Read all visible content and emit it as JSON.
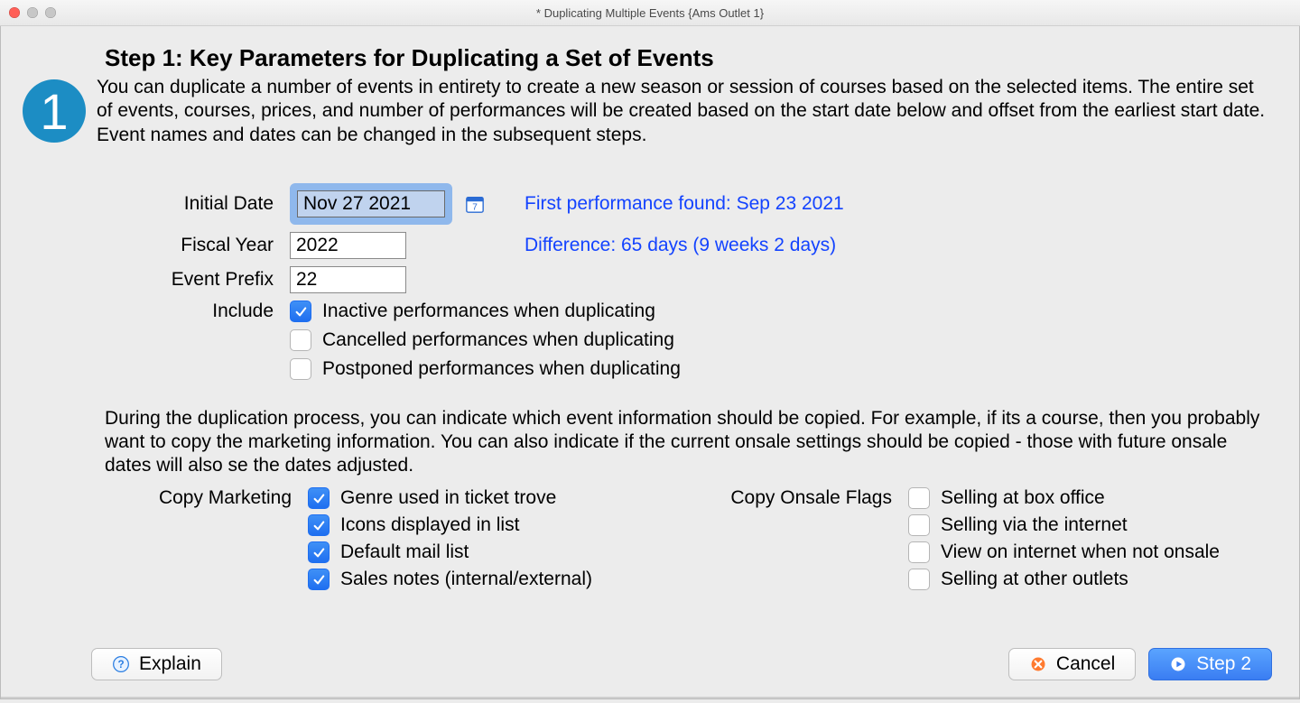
{
  "window": {
    "title": "* Duplicating Multiple Events {Ams Outlet 1}"
  },
  "step": {
    "badge": "1",
    "heading": "Step 1: Key Parameters for Duplicating a Set of Events",
    "intro": "You can duplicate a number of events in entirety to create a new season or session of courses based on the selected items.   The entire set of  events, courses, prices, and number of  performances will be created based on the start date below and offset from the earliest start date.   Event names and dates can be changed in the subsequent steps."
  },
  "form": {
    "initial_date": {
      "label": "Initial Date",
      "value": "Nov 27 2021"
    },
    "fiscal_year": {
      "label": "Fiscal Year",
      "value": "2022"
    },
    "event_prefix": {
      "label": "Event Prefix",
      "value": "22"
    },
    "include_label": "Include",
    "first_perf": "First performance found: Sep 23 2021",
    "difference": "Difference: 65 days (9 weeks 2 days)"
  },
  "include": {
    "inactive": {
      "label": "Inactive performances when duplicating",
      "checked": true
    },
    "cancelled": {
      "label": "Cancelled performances when duplicating",
      "checked": false
    },
    "postponed": {
      "label": "Postponed performances when duplicating",
      "checked": false
    }
  },
  "copy_intro": "During the duplication process, you can indicate which event information should be copied.  For example, if its a course, then you probably want to copy the marketing information.  You can also indicate if the current onsale settings should be copied - those with future onsale dates will also se the dates adjusted.",
  "copy_marketing": {
    "label": "Copy Marketing",
    "genre": {
      "label": "Genre used in ticket trove",
      "checked": true
    },
    "icons": {
      "label": "Icons displayed in  list",
      "checked": true
    },
    "mail": {
      "label": "Default mail list",
      "checked": true
    },
    "notes": {
      "label": "Sales notes (internal/external)",
      "checked": true
    }
  },
  "copy_onsale": {
    "label": "Copy Onsale Flags",
    "box": {
      "label": "Selling at box office",
      "checked": false
    },
    "web": {
      "label": "Selling via the internet",
      "checked": false
    },
    "view": {
      "label": "View on internet when not onsale",
      "checked": false
    },
    "outlets": {
      "label": "Selling at other outlets",
      "checked": false
    }
  },
  "buttons": {
    "explain": "Explain",
    "cancel": "Cancel",
    "next": "Step 2"
  },
  "icons": {
    "calendar": "calendar-icon",
    "help": "help-icon",
    "cancel": "cancel-icon",
    "play": "play-icon"
  }
}
